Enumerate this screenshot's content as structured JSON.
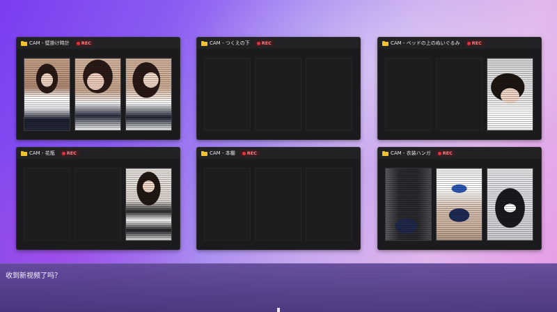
{
  "windows": [
    {
      "title": "CAM - 壁掛け時計",
      "rec": "REC",
      "panes": [
        "sailor",
        "sailor2",
        "sailor3"
      ]
    },
    {
      "title": "CAM - つくえの下",
      "rec": "REC",
      "panes": [
        "empty",
        "empty",
        "empty"
      ]
    },
    {
      "title": "CAM - ベッドの上のぬいぐるみ",
      "rec": "REC",
      "panes": [
        "empty",
        "empty",
        "bed"
      ]
    },
    {
      "title": "CAM - 花瓶",
      "rec": "REC",
      "panes": [
        "empty",
        "empty",
        "maid"
      ]
    },
    {
      "title": "CAM - 本棚",
      "rec": "REC",
      "panes": [
        "empty",
        "empty",
        "empty"
      ]
    },
    {
      "title": "CAM - 衣装ハンガ",
      "rec": "REC",
      "panes": [
        "uniform1",
        "uniform2",
        "uniform3"
      ]
    }
  ],
  "dialog": {
    "text": "收到新视频了吗？"
  },
  "colors": {
    "rec": "#e5333b",
    "folder": "#f2c230",
    "window_bg": "#1b1b1d"
  }
}
